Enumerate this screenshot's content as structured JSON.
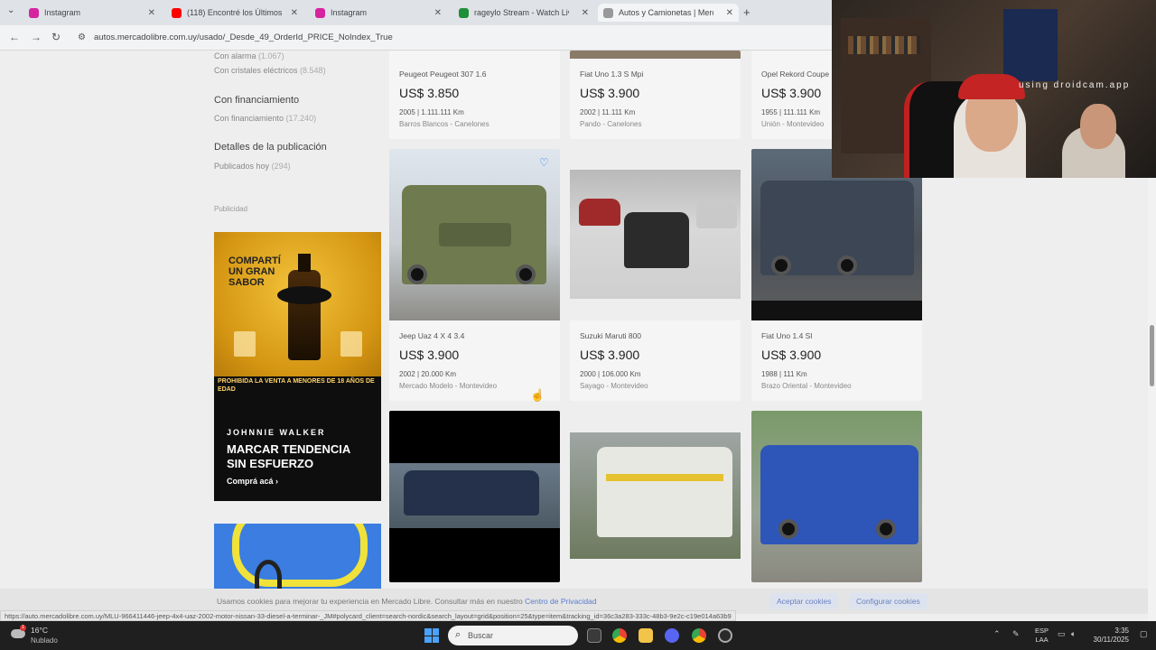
{
  "browser": {
    "tabs": [
      {
        "label": "Instagram",
        "color": "#d6249f",
        "active": false
      },
      {
        "label": "(118) Encontré los Últimos",
        "color": "#ff0000",
        "active": false
      },
      {
        "label": "Instagram",
        "color": "#d6249f",
        "active": false
      },
      {
        "label": "rageylo Stream - Watch Live on",
        "color": "#1f8f3a",
        "active": false
      },
      {
        "label": "Autos y Camionetas | Mercado",
        "color": "#999999",
        "active": true
      }
    ],
    "url": "autos.mercadolibre.com.uy/usado/_Desde_49_OrderId_PRICE_NoIndex_True"
  },
  "sidebar": {
    "top_filters": [
      {
        "label": "Con alarma",
        "count": "(1.067)"
      },
      {
        "label": "Con cristales eléctricos",
        "count": "(8.548)"
      }
    ],
    "financing": {
      "title": "Con financiamiento",
      "item": "Con financiamiento",
      "count": "(17.240)"
    },
    "publication": {
      "title": "Detalles de la publicación",
      "item": "Publicados hoy",
      "count": "(294)"
    },
    "ad_label": "Publicidad"
  },
  "ad": {
    "brand_lines": "COMPARTÍ UN GRAN SABOR",
    "warning": "PROHIBIDA LA VENTA A MENORES DE 18 AÑOS DE EDAD",
    "brand": "JOHNNIE WALKER",
    "headline": "MARCAR TENDENCIA SIN ESFUERZO",
    "cta": "Comprá acá"
  },
  "listings": [
    {
      "title": "Peugeot Peugeot 307 1.6",
      "price": "US$ 3.850",
      "meta": "2005 | 1.111.111 Km",
      "location": "Barros Blancos - Canelones"
    },
    {
      "title": "Fiat Uno 1.3 S Mpi",
      "price": "US$ 3.900",
      "meta": "2002 | 11.111 Km",
      "location": "Pando - Canelones"
    },
    {
      "title": "Opel Rekord Coupe",
      "price": "US$ 3.900",
      "meta": "1955 | 111.111 Km",
      "location": "Unión - Montevideo"
    },
    {
      "title": "Jeep Uaz 4 X 4 3.4",
      "price": "US$ 3.900",
      "meta": "2002 | 20.000 Km",
      "location": "Mercado Modelo - Montevideo"
    },
    {
      "title": "Suzuki Maruti 800",
      "price": "US$ 3.900",
      "meta": "2000 | 106.000 Km",
      "location": "Sayago - Montevideo"
    },
    {
      "title": "Fiat Uno 1.4 Sl",
      "price": "US$ 3.900",
      "meta": "1988 | 111 Km",
      "location": "Brazo Oriental - Montevideo"
    }
  ],
  "cookie": {
    "text": "Usamos cookies para mejorar tu experiencia en Mercado Libre. Consultar más en nuestro",
    "link": "Centro de Privacidad",
    "accept": "Aceptar cookies",
    "configure": "Configurar cookies"
  },
  "status_url": "https://auto.mercadolibre.com.uy/MLU-966411446-jeep-4x4-uaz-2002-motor-nissan-33-diesel-a-terminar-_JM#polycard_client=search-nordic&search_layout=grid&position=25&type=item&tracking_id=36c3a283-333c-48b3-9e2c-c19e014a63b9",
  "webcam": {
    "watermark": "using droidcam.app"
  },
  "taskbar": {
    "temp": "16°C",
    "condition": "Nublado",
    "weather_badge": "1",
    "search_placeholder": "Buscar",
    "lang_top": "ESP",
    "lang_bottom": "LAA",
    "time": "3:35",
    "date": "30/11/2025"
  }
}
